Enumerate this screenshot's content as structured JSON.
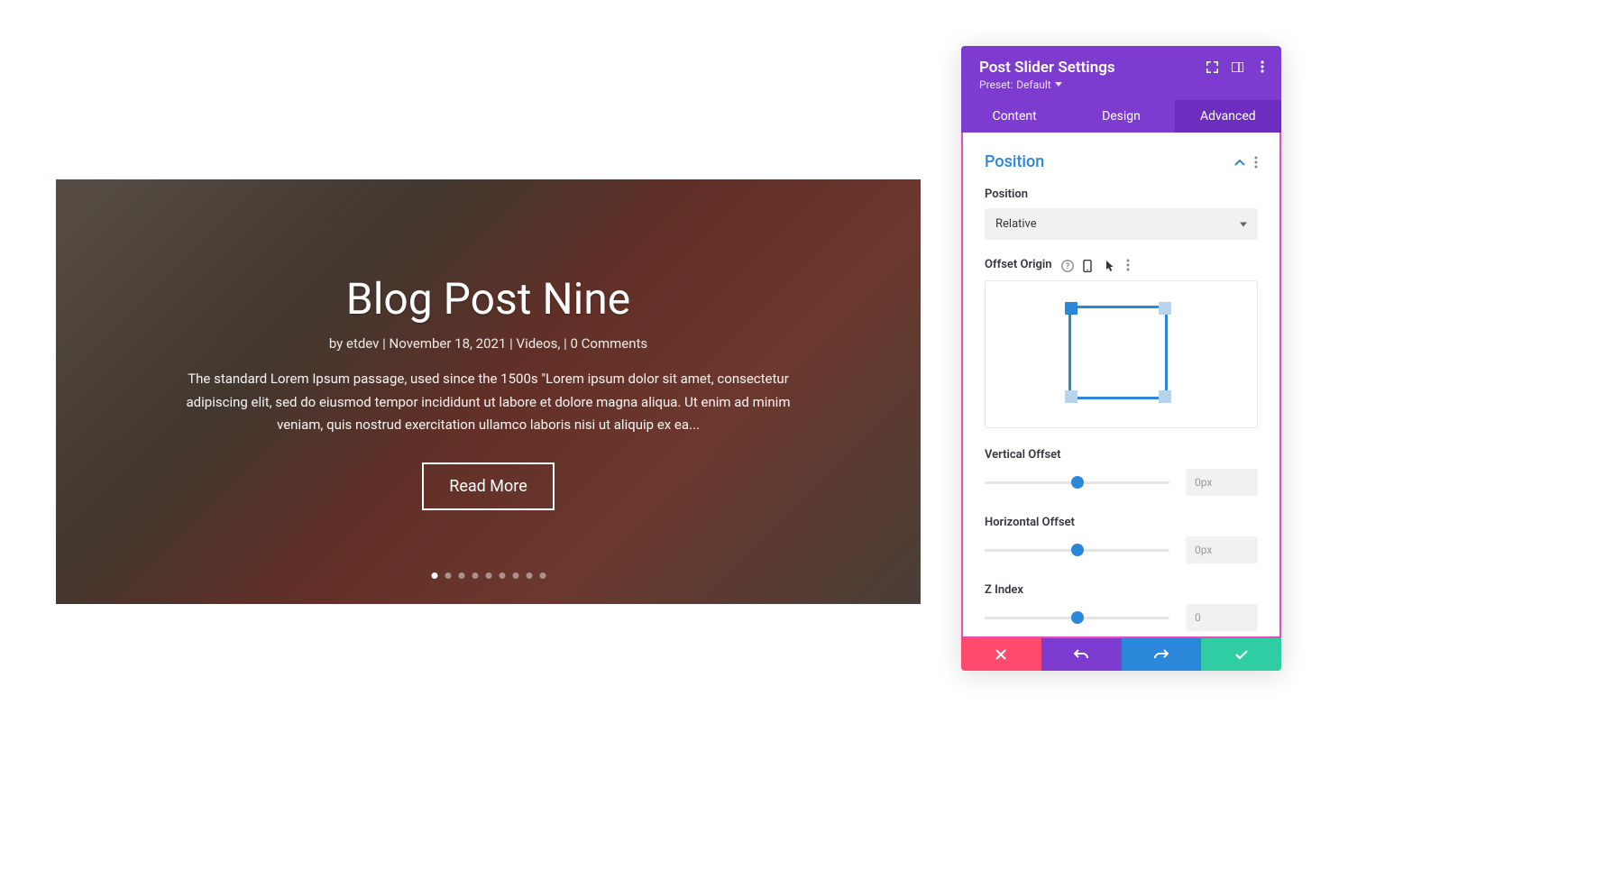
{
  "slider": {
    "title": "Blog Post Nine",
    "meta_by": "by ",
    "meta_author": "etdev",
    "meta_date": "November 18, 2021",
    "meta_category": "Videos,",
    "meta_comments": "0 Comments",
    "meta_sep": " | ",
    "excerpt": "The standard Lorem Ipsum passage, used since the 1500s \"Lorem ipsum dolor sit amet, consectetur adipiscing elit, sed do eiusmod tempor incididunt ut labore et dolore magna aliqua. Ut enim ad minim veniam, quis nostrud exercitation ullamco laboris nisi ut aliquip ex ea...",
    "read_more": "Read More",
    "dot_count": 9,
    "active_dot": 0
  },
  "panel": {
    "title": "Post Slider Settings",
    "preset_prefix": "Preset: ",
    "preset_value": "Default",
    "tabs": {
      "content": "Content",
      "design": "Design",
      "advanced": "Advanced",
      "active": "advanced"
    },
    "section": {
      "title": "Position",
      "position_label": "Position",
      "position_value": "Relative",
      "offset_origin_label": "Offset Origin",
      "vertical_offset_label": "Vertical Offset",
      "vertical_offset_value": "0px",
      "horizontal_offset_label": "Horizontal Offset",
      "horizontal_offset_value": "0px",
      "z_index_label": "Z Index",
      "z_index_value": "0"
    }
  },
  "colors": {
    "purple": "#7e3bd0",
    "blue": "#2b87da",
    "pink": "#e94bb4",
    "red": "#ff4a6e",
    "teal": "#2ecda4"
  }
}
